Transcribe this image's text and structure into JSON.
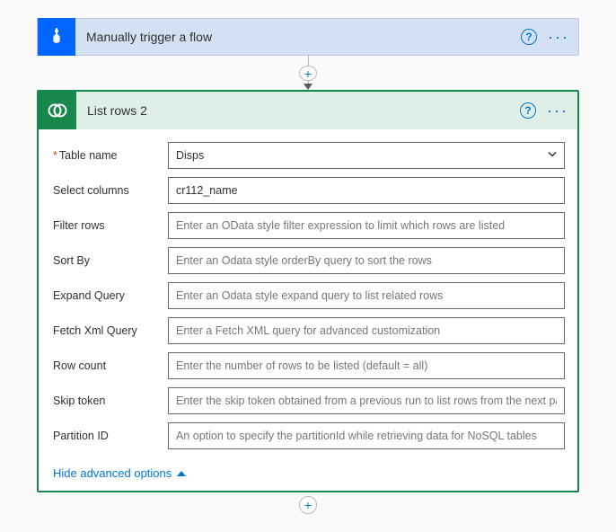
{
  "trigger": {
    "title": "Manually trigger a flow"
  },
  "action": {
    "title": "List rows 2",
    "fields": {
      "table_name": {
        "label": "Table name",
        "required": true,
        "value": "Disps"
      },
      "select_columns": {
        "label": "Select columns",
        "value": "cr112_name"
      },
      "filter_rows": {
        "label": "Filter rows",
        "placeholder": "Enter an OData style filter expression to limit which rows are listed"
      },
      "sort_by": {
        "label": "Sort By",
        "placeholder": "Enter an Odata style orderBy query to sort the rows"
      },
      "expand_query": {
        "label": "Expand Query",
        "placeholder": "Enter an Odata style expand query to list related rows"
      },
      "fetch_xml": {
        "label": "Fetch Xml Query",
        "placeholder": "Enter a Fetch XML query for advanced customization"
      },
      "row_count": {
        "label": "Row count",
        "placeholder": "Enter the number of rows to be listed (default = all)"
      },
      "skip_token": {
        "label": "Skip token",
        "placeholder": "Enter the skip token obtained from a previous run to list rows from the next pa"
      },
      "partition_id": {
        "label": "Partition ID",
        "placeholder": "An option to specify the partitionId while retrieving data for NoSQL tables"
      }
    },
    "hide_advanced_label": "Hide advanced options"
  }
}
